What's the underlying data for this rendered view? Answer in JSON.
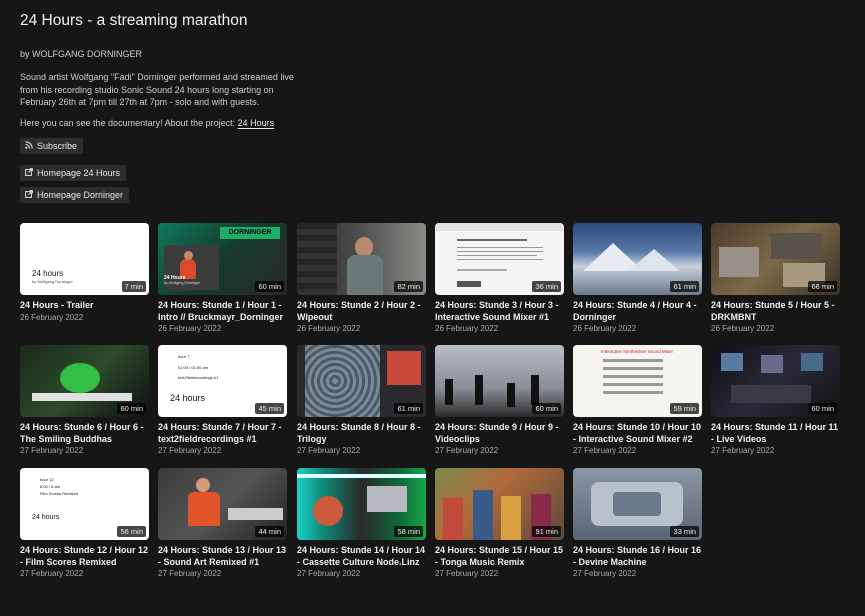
{
  "page": {
    "title": "24 Hours - a streaming marathon",
    "author": "by WOLFGANG DORNINGER",
    "description": "Sound artist Wolfgang \"Fadi\" Dorninger performed and streamed live\nfrom his recording studio Sonic Sound 24 hours long starting on\nFebruary 26th at 7pm till 27th at 7pm - solo and with guests.",
    "about_prefix": "Here you can see the documentary! About the project:",
    "about_link": "24 Hours"
  },
  "buttons": {
    "subscribe": "Subscribe",
    "homepage_24": "Homepage 24 Hours",
    "homepage_dorninger": "Homepage Dorninger"
  },
  "icons": {
    "rss": "rss-icon",
    "external": "external-link-icon"
  },
  "thumb_text": {
    "t1_big": "24 hours",
    "t1_small": "by Wolfgang Dorninger",
    "t2_banner": "DORNINGER",
    "t2_big": "24 Hours",
    "t2_small": "by Wolfgang Dorninger",
    "t7_line1": "hour 7",
    "t7_line2": "01:00 / 01:00 am",
    "t7_line3": "text2fieldrecordings #1",
    "t7_big": "24 hours",
    "t12_line1": "hour 12",
    "t12_line2": "6:00 / 6 am",
    "t12_line3": "Film Scores Remixed",
    "t12_big": "24 hours",
    "t10_header": "Interactive Synthesiser Sound Mixer"
  },
  "videos": [
    {
      "title": "24 Hours - Trailer",
      "date": "26 February 2022",
      "duration": "7 min"
    },
    {
      "title": "24 Hours: Stunde 1 / Hour 1 - Intro // Bruckmayr_Dorninger",
      "date": "26 February 2022",
      "duration": "60 min"
    },
    {
      "title": "24 Hours: Stunde 2 / Hour 2 - Wipeout",
      "date": "26 February 2022",
      "duration": "82 min"
    },
    {
      "title": "24 Hours: Stunde 3 / Hour 3 - Interactive Sound Mixer #1",
      "date": "26 February 2022",
      "duration": "36 min"
    },
    {
      "title": "24 Hours: Stunde 4 / Hour 4 - Dorninger",
      "date": "26 February 2022",
      "duration": "61 min"
    },
    {
      "title": "24 Hours: Stunde 5 / Hour 5 - DRKMBNT",
      "date": "26 February 2022",
      "duration": "66 min"
    },
    {
      "title": "24 Hours: Stunde 6 / Hour 6 - The Smiling Buddhas",
      "date": "27 February 2022",
      "duration": "60 min"
    },
    {
      "title": "24 Hours: Stunde 7 / Hour 7 - text2fieldrecordings #1",
      "date": "27 February 2022",
      "duration": "45 min"
    },
    {
      "title": "24 Hours: Stunde 8 / Hour 8 - Trilogy",
      "date": "27 February 2022",
      "duration": "61 min"
    },
    {
      "title": "24 Hours: Stunde 9 / Hour 9 - Videoclips",
      "date": "27 February 2022",
      "duration": "60 min"
    },
    {
      "title": "24 Hours: Stunde 10 / Hour 10 - Interactive Sound Mixer #2",
      "date": "27 February 2022",
      "duration": "59 min"
    },
    {
      "title": "24 Hours: Stunde 11 / Hour 11 - Live Videos",
      "date": "27 February 2022",
      "duration": "60 min"
    },
    {
      "title": "24 Hours: Stunde 12 / Hour 12 - Film Scores Remixed",
      "date": "27 February 2022",
      "duration": "56 min"
    },
    {
      "title": "24 Hours: Stunde 13 / Hour 13 - Sound Art Remixed #1",
      "date": "27 February 2022",
      "duration": "44 min"
    },
    {
      "title": "24 Hours: Stunde 14 / Hour 14 - Cassette Culture Node.Linz",
      "date": "27 February 2022",
      "duration": "58 min"
    },
    {
      "title": "24 Hours: Stunde 15 / Hour 15 - Tonga Music Remix",
      "date": "27 February 2022",
      "duration": "91 min"
    },
    {
      "title": "24 Hours: Stunde 16 / Hour 16 - Devine Machine",
      "date": "27 February 2022",
      "duration": "33 min"
    }
  ]
}
